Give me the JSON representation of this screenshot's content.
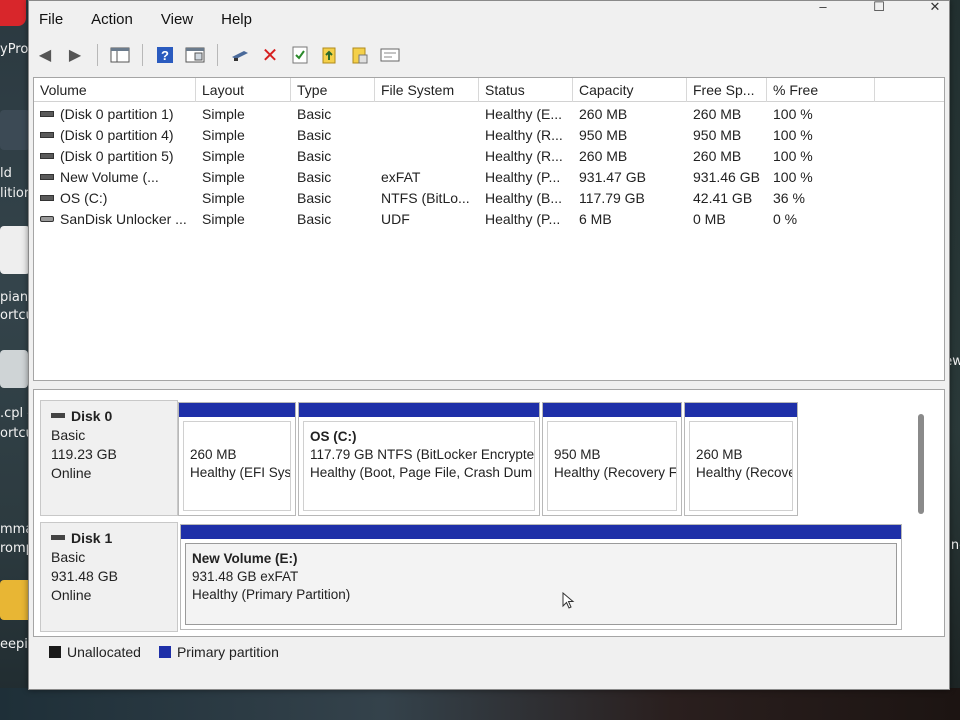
{
  "desktop": {
    "left_labels": [
      "yPro",
      "ld",
      "litior",
      "piano",
      "ortcut",
      ".cpl -",
      "ortcut",
      "mmano",
      "rompt",
      "eepianc"
    ],
    "right_labels": [
      "View",
      "s and"
    ]
  },
  "window": {
    "menu": [
      "File",
      "Action",
      "View",
      "Help"
    ]
  },
  "toolbar": {
    "icons": [
      "back-arrow-icon",
      "forward-arrow-icon",
      "console-tree-icon",
      "help-icon",
      "properties-icon",
      "connect-icon",
      "delete-icon",
      "check-icon",
      "open-folder-icon",
      "explore-icon",
      "view-icon"
    ]
  },
  "volume_list": {
    "columns": [
      "Volume",
      "Layout",
      "Type",
      "File System",
      "Status",
      "Capacity",
      "Free Sp...",
      "% Free"
    ],
    "rows": [
      {
        "volume": "(Disk 0 partition 1)",
        "layout": "Simple",
        "type": "Basic",
        "fs": "",
        "status": "Healthy (E...",
        "capacity": "260 MB",
        "free": "260 MB",
        "pct": "100 %"
      },
      {
        "volume": "(Disk 0 partition 4)",
        "layout": "Simple",
        "type": "Basic",
        "fs": "",
        "status": "Healthy (R...",
        "capacity": "950 MB",
        "free": "950 MB",
        "pct": "100 %"
      },
      {
        "volume": "(Disk 0 partition 5)",
        "layout": "Simple",
        "type": "Basic",
        "fs": "",
        "status": "Healthy (R...",
        "capacity": "260 MB",
        "free": "260 MB",
        "pct": "100 %"
      },
      {
        "volume": "New Volume (...",
        "layout": "Simple",
        "type": "Basic",
        "fs": "exFAT",
        "status": "Healthy (P...",
        "capacity": "931.47 GB",
        "free": "931.46 GB",
        "pct": "100 %"
      },
      {
        "volume": "OS (C:)",
        "layout": "Simple",
        "type": "Basic",
        "fs": "NTFS (BitLo...",
        "status": "Healthy (B...",
        "capacity": "117.79 GB",
        "free": "42.41 GB",
        "pct": "36 %"
      },
      {
        "volume": "SanDisk Unlocker ...",
        "layout": "Simple",
        "type": "Basic",
        "fs": "UDF",
        "status": "Healthy (P...",
        "capacity": "6 MB",
        "free": "0 MB",
        "pct": "0 %"
      }
    ]
  },
  "disks": [
    {
      "name": "Disk 0",
      "kind": "Basic",
      "size": "119.23 GB",
      "state": "Online",
      "partitions": [
        {
          "title": "",
          "line1": "260 MB",
          "line2": "Healthy (EFI Sys"
        },
        {
          "title": "OS  (C:)",
          "line1": "117.79 GB NTFS (BitLocker Encrypte",
          "line2": "Healthy (Boot, Page File, Crash Dum"
        },
        {
          "title": "",
          "line1": "950 MB",
          "line2": "Healthy (Recovery F"
        },
        {
          "title": "",
          "line1": "260 MB",
          "line2": "Healthy (Recove"
        }
      ]
    },
    {
      "name": "Disk 1",
      "kind": "Basic",
      "size": "931.48 GB",
      "state": "Online",
      "partitions": [
        {
          "title": "New Volume  (E:)",
          "line1": "931.48 GB exFAT",
          "line2": "Healthy (Primary Partition)"
        }
      ]
    }
  ],
  "legend": {
    "items": [
      {
        "label": "Unallocated",
        "color": "#1a1a1a"
      },
      {
        "label": "Primary partition",
        "color": "#1e2fa8"
      }
    ]
  },
  "colors": {
    "partition_bar": "#1e2fa8"
  }
}
